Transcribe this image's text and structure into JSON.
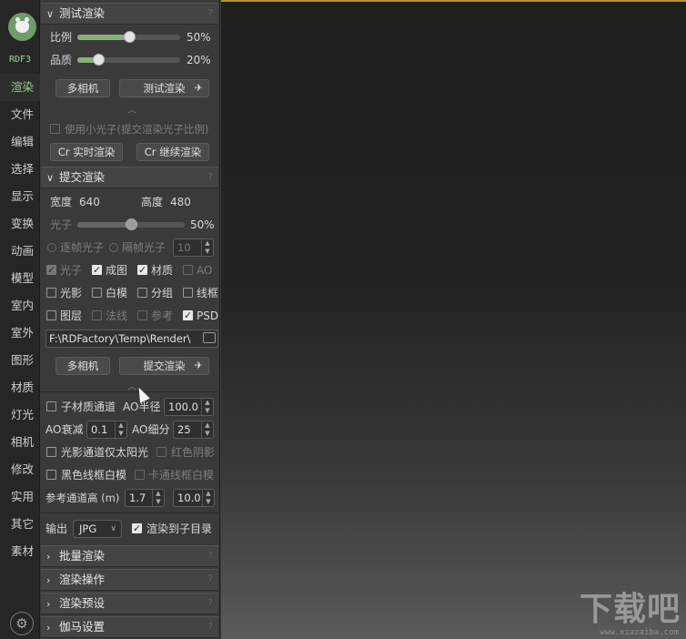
{
  "nav": {
    "logo_text": "RDF3",
    "items": [
      "渲染",
      "文件",
      "编辑",
      "选择",
      "显示",
      "变换",
      "动画",
      "模型",
      "室内",
      "室外",
      "图形",
      "材质",
      "灯光",
      "相机",
      "修改",
      "实用",
      "其它",
      "素材"
    ],
    "active": "渲染"
  },
  "test_render": {
    "title": "测试渲染",
    "ratio_label": "比例",
    "ratio_value": "50%",
    "ratio_fraction": 0.5,
    "quality_label": "品质",
    "quality_value": "20%",
    "quality_fraction": 0.2,
    "multi_camera": "多相机",
    "test_render_btn": "测试渲染",
    "small_photon": "使用小光子(提交渲染光子比例)",
    "cr_realtime": "Cr 实时渲染",
    "cr_continue": "Cr 继续渲染"
  },
  "submit_render": {
    "title": "提交渲染",
    "width_label": "宽度",
    "width_value": "640",
    "height_label": "高度",
    "height_value": "480",
    "photon_label": "光子",
    "photon_value": "50%",
    "photon_fraction": 0.5,
    "per_frame": "逐帧光子",
    "skip_frame": "隔帧光子",
    "skip_value": "10",
    "channels_row1": [
      {
        "label": "光子",
        "checked": true,
        "dim": true
      },
      {
        "label": "成图",
        "checked": true,
        "dim": false
      },
      {
        "label": "材质",
        "checked": true,
        "dim": false
      },
      {
        "label": "AO",
        "checked": false,
        "dim": true
      }
    ],
    "channels_row2": [
      {
        "label": "光影",
        "checked": false,
        "dim": false
      },
      {
        "label": "白模",
        "checked": false,
        "dim": false
      },
      {
        "label": "分组",
        "checked": false,
        "dim": false
      },
      {
        "label": "线框",
        "checked": false,
        "dim": false
      }
    ],
    "channels_row3": [
      {
        "label": "图层",
        "checked": false,
        "dim": false
      },
      {
        "label": "法线",
        "checked": false,
        "dim": true
      },
      {
        "label": "参考",
        "checked": false,
        "dim": true
      },
      {
        "label": "PSD",
        "checked": true,
        "dim": false
      }
    ],
    "path": "F:\\RDFactory\\Temp\\Render\\",
    "multi_camera": "多相机",
    "submit_btn": "提交渲染"
  },
  "advanced": {
    "sub_material": "子材质通道",
    "ao_radius_label": "AO半径",
    "ao_radius": "100.0",
    "ao_falloff_label": "AO衰减",
    "ao_falloff": "0.1",
    "ao_subdiv_label": "AO细分",
    "ao_subdiv": "25",
    "light_sun_only": "光影通道仅太阳光",
    "red_shadow": "红色阴影",
    "black_wire": "黑色线框白模",
    "cartoon_wire": "卡通线框白模",
    "ref_height_label": "参考通道高 (m)",
    "ref_a": "1.7",
    "ref_b": "10.0",
    "output_label": "输出",
    "output_format": "JPG",
    "subdir_label": "渲染到子目录"
  },
  "collapsed_sections": [
    "批量渲染",
    "渲染操作",
    "渲染预设",
    "伽马设置"
  ],
  "help_mark": "?",
  "watermark": {
    "main": "下载吧",
    "sub": "www.xiazaiba.com"
  },
  "colors": {
    "accent": "#86b07e",
    "active_nav": "#8ed08a",
    "viewport_border": "#b8912f"
  }
}
